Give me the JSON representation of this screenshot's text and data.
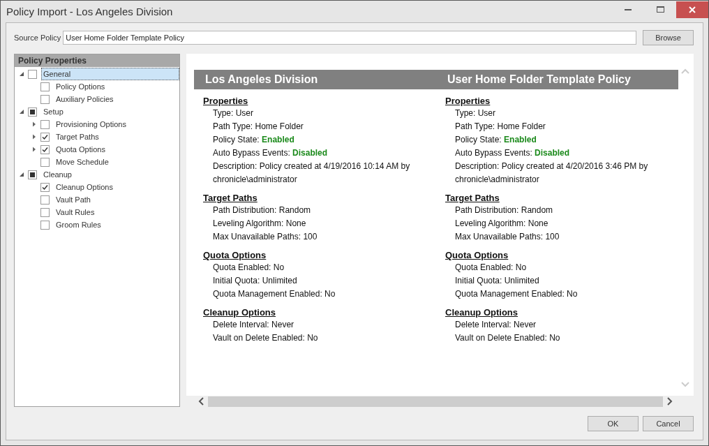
{
  "window": {
    "title": "Policy Import - Los Angeles Division"
  },
  "source_policy": {
    "label": "Source Policy",
    "value": "User Home Folder Template Policy",
    "browse": "Browse"
  },
  "tree": {
    "title": "Policy Properties",
    "items": [
      {
        "label": "General",
        "checked": false,
        "selected": true,
        "expanded": true,
        "children": [
          {
            "label": "Policy Options",
            "checked": false,
            "selected": false
          },
          {
            "label": "Auxiliary Policies",
            "checked": false,
            "selected": false
          }
        ]
      },
      {
        "label": "Setup",
        "checked": false,
        "mixed": true,
        "selected": false,
        "expanded": true,
        "children": [
          {
            "label": "Provisioning Options",
            "checked": false,
            "selected": false,
            "expanded": false
          },
          {
            "label": "Target Paths",
            "checked": true,
            "selected": false,
            "expanded": false
          },
          {
            "label": "Quota Options",
            "checked": true,
            "selected": false,
            "expanded": false
          },
          {
            "label": "Move Schedule",
            "checked": false,
            "selected": false
          }
        ]
      },
      {
        "label": "Cleanup",
        "checked": false,
        "mixed": true,
        "selected": false,
        "expanded": true,
        "children": [
          {
            "label": "Cleanup Options",
            "checked": true,
            "selected": false
          },
          {
            "label": "Vault Path",
            "checked": false,
            "selected": false
          },
          {
            "label": "Vault Rules",
            "checked": false,
            "selected": false
          },
          {
            "label": "Groom Rules",
            "checked": false,
            "selected": false
          }
        ]
      }
    ]
  },
  "report": {
    "columns": [
      {
        "title": "Los Angeles Division",
        "sections": [
          {
            "heading": "Properties",
            "lines": [
              {
                "text": "Type: User"
              },
              {
                "text": "Path Type: Home Folder"
              },
              {
                "text": "Policy State:",
                "status": "Enabled"
              },
              {
                "text": "Auto Bypass Events:",
                "status": "Disabled"
              },
              {
                "text": "Description: Policy created at 4/19/2016 10:14 AM by chronicle\\administrator"
              }
            ]
          },
          {
            "heading": "Target Paths",
            "lines": [
              {
                "text": "Path Distribution: Random"
              },
              {
                "text": "Leveling Algorithm: None"
              },
              {
                "text": "Max Unavailable Paths: 100"
              }
            ]
          },
          {
            "heading": "Quota Options",
            "lines": [
              {
                "text": "Quota Enabled: No"
              },
              {
                "text": "Initial Quota: Unlimited"
              },
              {
                "text": "Quota Management Enabled: No"
              }
            ]
          },
          {
            "heading": "Cleanup Options",
            "lines": [
              {
                "text": "Delete Interval: Never"
              },
              {
                "text": "Vault on Delete Enabled: No"
              }
            ]
          }
        ]
      },
      {
        "title": "User Home Folder Template Policy",
        "sections": [
          {
            "heading": "Properties",
            "lines": [
              {
                "text": "Type: User"
              },
              {
                "text": "Path Type: Home Folder"
              },
              {
                "text": "Policy State:",
                "status": "Enabled"
              },
              {
                "text": "Auto Bypass Events:",
                "status": "Disabled"
              },
              {
                "text": "Description: Policy created at 4/20/2016 3:46 PM by chronicle\\administrator"
              }
            ]
          },
          {
            "heading": "Target Paths",
            "lines": [
              {
                "text": "Path Distribution: Random"
              },
              {
                "text": "Leveling Algorithm: None"
              },
              {
                "text": "Max Unavailable Paths: 100"
              }
            ]
          },
          {
            "heading": "Quota Options",
            "lines": [
              {
                "text": "Quota Enabled: No"
              },
              {
                "text": "Initial Quota: Unlimited"
              },
              {
                "text": "Quota Management Enabled: No"
              }
            ]
          },
          {
            "heading": "Cleanup Options",
            "lines": [
              {
                "text": "Delete Interval: Never"
              },
              {
                "text": "Vault on Delete Enabled: No"
              }
            ]
          }
        ]
      }
    ]
  },
  "buttons": [
    "OK",
    "Cancel"
  ]
}
